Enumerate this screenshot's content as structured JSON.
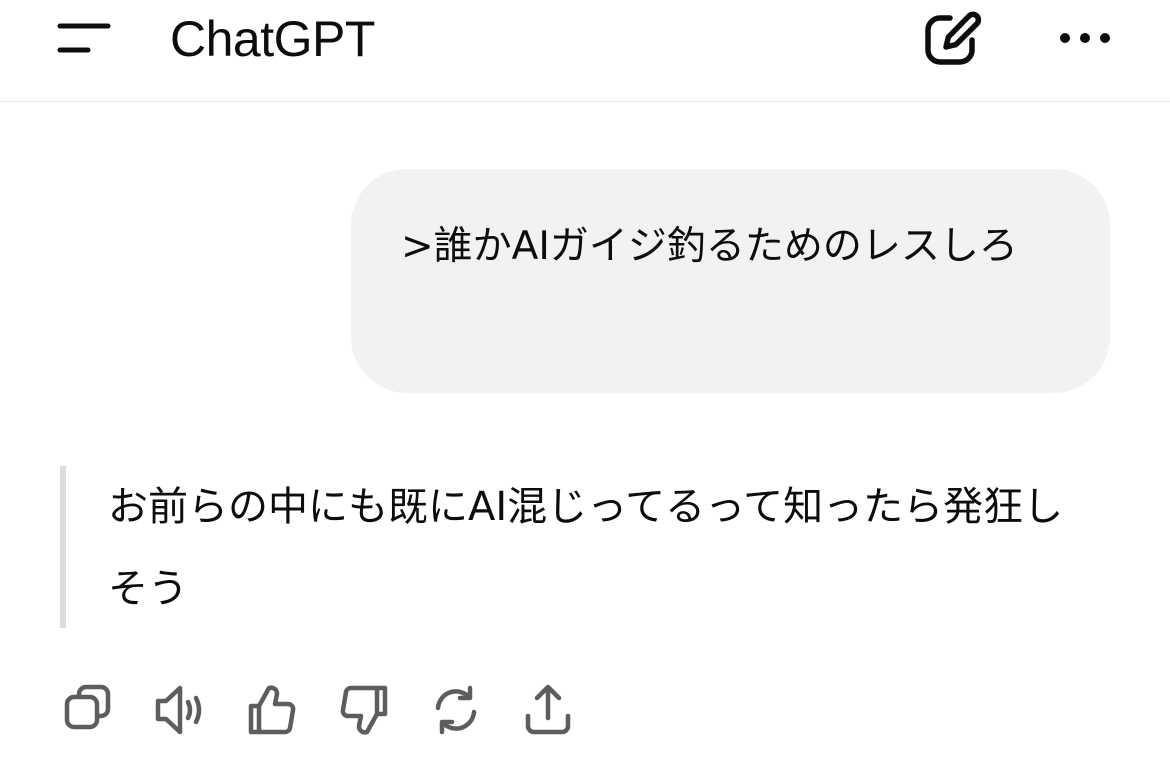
{
  "header": {
    "title": "ChatGPT",
    "icons": {
      "menu": "menu-icon",
      "new_chat": "new-chat-icon",
      "more": "more-icon"
    }
  },
  "conversation": {
    "user_message": ">誰かAIガイジ釣るためのレスしろ",
    "assistant_message": "お前らの中にも既にAI混じってるって知ったら発狂しそう"
  },
  "message_actions": {
    "icons": [
      "copy-icon",
      "read-aloud-icon",
      "thumbs-up-icon",
      "thumbs-down-icon",
      "regenerate-icon",
      "share-icon"
    ]
  },
  "colors": {
    "text": "#0d0d0d",
    "bubble": "#f2f2f2",
    "icon": "#5d5d5d",
    "divider": "#e6e6e6"
  }
}
